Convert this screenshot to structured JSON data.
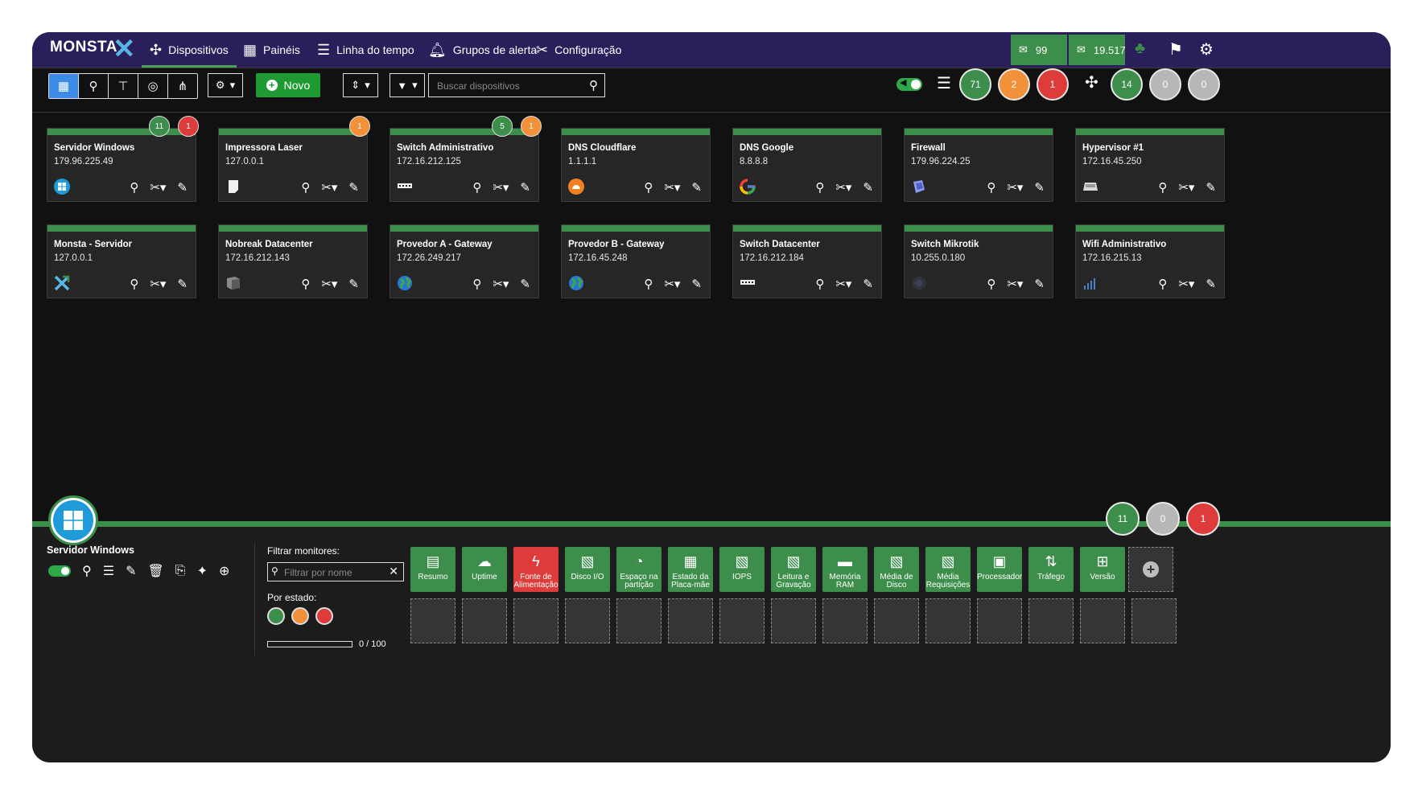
{
  "brand": {
    "name": "MONSTA"
  },
  "nav": [
    {
      "label": "Dispositivos",
      "icon": "nodes-icon"
    },
    {
      "label": "Painéis",
      "icon": "grid-icon"
    },
    {
      "label": "Linha do tempo",
      "icon": "timeline-icon"
    },
    {
      "label": "Grupos de alerta",
      "icon": "bell-icon"
    },
    {
      "label": "Configuração",
      "icon": "tools-icon"
    }
  ],
  "header_counters": {
    "sms": "99",
    "email": "19.517"
  },
  "toolbar": {
    "new_label": "Novo",
    "search_placeholder": "Buscar dispositivos",
    "list_counts": {
      "ok": "71",
      "warn": "2",
      "crit": "1"
    },
    "topology_counts": {
      "ok": "14",
      "a": "0",
      "b": "0"
    }
  },
  "devices": [
    {
      "name": "Servidor Windows",
      "ip": "179.96.225.49",
      "icon": "windows-icon",
      "badges": [
        {
          "v": "11",
          "c": "green"
        },
        {
          "v": "1",
          "c": "red"
        }
      ]
    },
    {
      "name": "Impressora Laser",
      "ip": "127.0.0.1",
      "icon": "printer-icon",
      "badges": [
        {
          "v": "1",
          "c": "orange"
        }
      ]
    },
    {
      "name": "Switch Administrativo",
      "ip": "172.16.212.125",
      "icon": "switch-icon",
      "badges": [
        {
          "v": "5",
          "c": "green"
        },
        {
          "v": "1",
          "c": "orange"
        }
      ]
    },
    {
      "name": "DNS Cloudflare",
      "ip": "1.1.1.1",
      "icon": "cloudflare-icon",
      "badges": []
    },
    {
      "name": "DNS Google",
      "ip": "8.8.8.8",
      "icon": "google-icon",
      "badges": []
    },
    {
      "name": "Firewall",
      "ip": "179.96.224.25",
      "icon": "firewall-icon",
      "badges": []
    },
    {
      "name": "Hypervisor #1",
      "ip": "172.16.45.250",
      "icon": "server-icon",
      "badges": []
    },
    {
      "name": "Monsta - Servidor",
      "ip": "127.0.0.1",
      "icon": "monsta-icon",
      "badges": []
    },
    {
      "name": "Nobreak Datacenter",
      "ip": "172.16.212.143",
      "icon": "ups-icon",
      "badges": []
    },
    {
      "name": "Provedor A - Gateway",
      "ip": "172.26.249.217",
      "icon": "globe-icon",
      "badges": []
    },
    {
      "name": "Provedor B - Gateway",
      "ip": "172.16.45.248",
      "icon": "globe-icon",
      "badges": []
    },
    {
      "name": "Switch Datacenter",
      "ip": "172.16.212.184",
      "icon": "switch-icon",
      "badges": []
    },
    {
      "name": "Switch Mikrotik",
      "ip": "10.255.0.180",
      "icon": "mikrotik-icon",
      "badges": []
    },
    {
      "name": "Wifi Administrativo",
      "ip": "172.16.215.13",
      "icon": "wifi-bars-icon",
      "badges": []
    }
  ],
  "selected": {
    "name": "Servidor Windows",
    "counts": {
      "ok": "11",
      "unknown": "0",
      "crit": "1"
    },
    "filter_label": "Filtrar monitores:",
    "filter_placeholder": "Filtrar por nome",
    "state_label": "Por estado:",
    "progress_text": "0 / 100",
    "progress_value": 0
  },
  "monitors": [
    {
      "label": "Resumo",
      "icon": "▤",
      "status": "green"
    },
    {
      "label": "Uptime",
      "icon": "☁",
      "status": "green"
    },
    {
      "label": "Fonte de Alimentação",
      "icon": "ϟ",
      "status": "red"
    },
    {
      "label": "Disco I/O",
      "icon": "▧",
      "status": "green"
    },
    {
      "label": "Espaço na partição",
      "icon": "◔",
      "status": "green"
    },
    {
      "label": "Estado da Placa-mãe",
      "icon": "▦",
      "status": "green"
    },
    {
      "label": "IOPS",
      "icon": "▧",
      "status": "green"
    },
    {
      "label": "Leitura e Gravação",
      "icon": "▧",
      "status": "green"
    },
    {
      "label": "Memória RAM",
      "icon": "▬",
      "status": "green"
    },
    {
      "label": "Média de Disco",
      "icon": "▧",
      "status": "green"
    },
    {
      "label": "Média Requisições",
      "icon": "▧",
      "status": "green"
    },
    {
      "label": "Processador",
      "icon": "▣",
      "status": "green"
    },
    {
      "label": "Tráfego",
      "icon": "⇅",
      "status": "green"
    },
    {
      "label": "Versão",
      "icon": "⊞",
      "status": "green"
    }
  ]
}
